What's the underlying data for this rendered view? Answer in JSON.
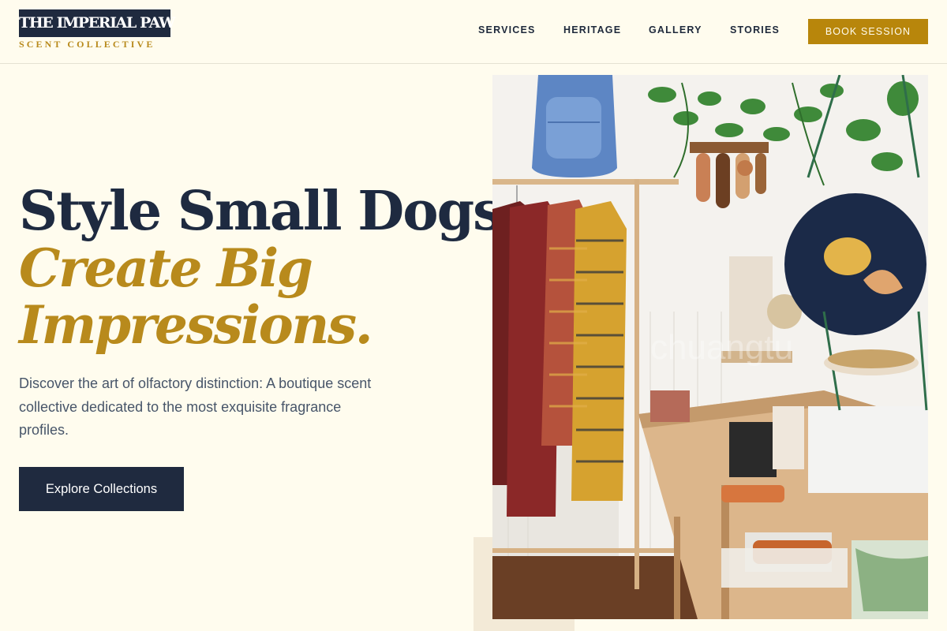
{
  "brand": {
    "name": "THE IMPERIAL PAW",
    "tagline": "SCENT COLLECTIVE"
  },
  "nav": {
    "links": [
      "SERVICES",
      "HERITAGE",
      "GALLERY",
      "STORIES"
    ],
    "cta_label": "BOOK SESSION"
  },
  "hero": {
    "title_line1": "Style Small Dogs,",
    "title_accent_line1": "Create Big",
    "title_accent_line2": "Impressions.",
    "description": "Discover the art of olfactory distinction: A boutique scent collective dedicated to the most exquisite fragrance profiles.",
    "cta_label": "Explore Collections",
    "image_watermark": "chuangtu"
  },
  "colors": {
    "background": "#fffcee",
    "navy": "#1f2a3f",
    "gold": "#b8860b",
    "accent_text": "#b88a1c"
  }
}
